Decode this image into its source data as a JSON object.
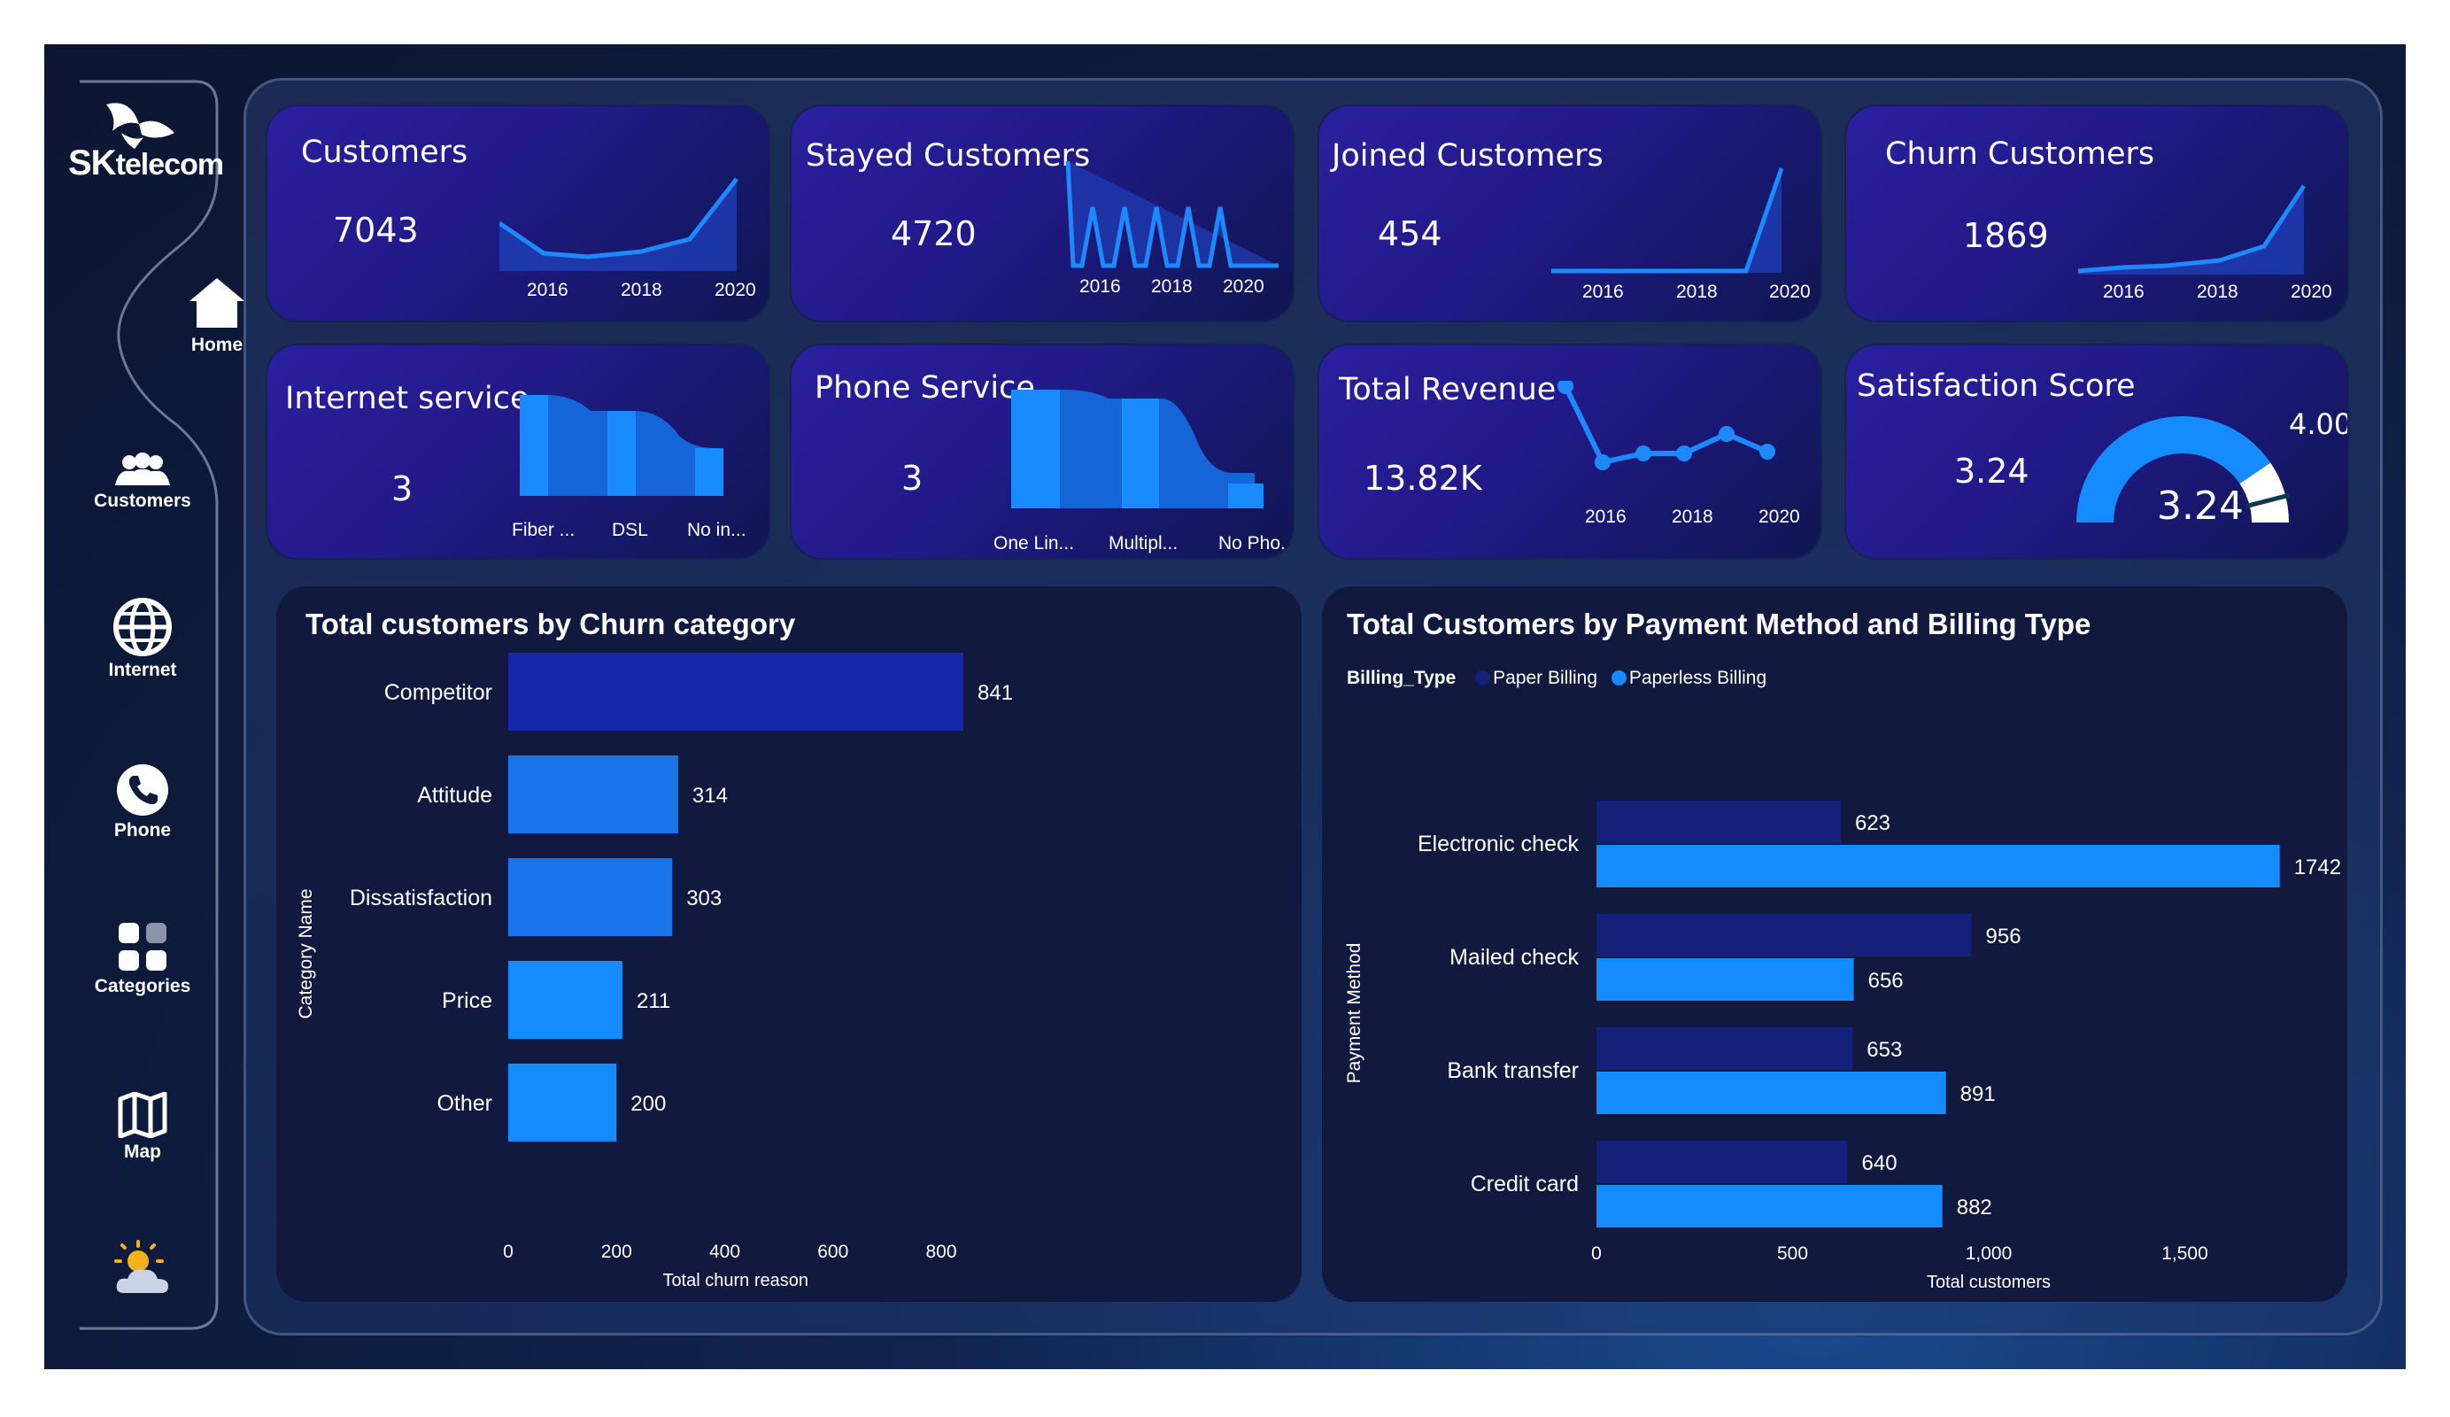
{
  "brand": {
    "name_main": "SK",
    "name_sub": "telecom"
  },
  "sidebar": {
    "items": [
      {
        "label": "Home",
        "icon": "home-icon"
      },
      {
        "label": "Customers",
        "icon": "users-icon"
      },
      {
        "label": "Internet",
        "icon": "globe-icon"
      },
      {
        "label": "Phone",
        "icon": "phone-icon"
      },
      {
        "label": "Categories",
        "icon": "grid-icon"
      },
      {
        "label": "Map",
        "icon": "map-icon"
      },
      {
        "label": "",
        "icon": "weather-icon"
      }
    ]
  },
  "kpi_cards": {
    "customers": {
      "title": "Customers",
      "value": "7043",
      "ticks": [
        "2016",
        "2018",
        "2020"
      ]
    },
    "stayed": {
      "title": "Stayed Customers",
      "value": "4720",
      "ticks": [
        "2016",
        "2018",
        "2020"
      ]
    },
    "joined": {
      "title": "Joined Customers",
      "value": "454",
      "ticks": [
        "2016",
        "2018",
        "2020"
      ]
    },
    "churn": {
      "title": "Churn Customers",
      "value": "1869",
      "ticks": [
        "2016",
        "2018",
        "2020"
      ]
    },
    "internet": {
      "title": "Internet service",
      "value": "3",
      "ticks": [
        "Fiber ...",
        "DSL",
        "No in..."
      ]
    },
    "phone": {
      "title": "Phone Service",
      "value": "3",
      "ticks": [
        "One Lin...",
        "Multipl...",
        "No Pho..."
      ]
    },
    "revenue": {
      "title": "Total Revenue",
      "value": "13.82K",
      "ticks": [
        "2016",
        "2018",
        "2020"
      ]
    },
    "satisfaction": {
      "title": "Satisfaction Score",
      "value": "3.24",
      "gauge_value": "3.24",
      "gauge_max": "4.00",
      "gauge_fraction": 0.81
    }
  },
  "chart_data": [
    {
      "type": "bar",
      "orientation": "horizontal",
      "title": "Total customers by Churn category",
      "xlabel": "Total churn reason",
      "ylabel": "Category Name",
      "categories": [
        "Competitor",
        "Attitude",
        "Dissatisfaction",
        "Price",
        "Other"
      ],
      "values": [
        841,
        314,
        303,
        211,
        200
      ],
      "xticks": [
        "0",
        "200",
        "400",
        "600",
        "800"
      ],
      "xlim": [
        0,
        900
      ],
      "colors": [
        "#1626a8",
        "#1a73e8",
        "#1a73e8",
        "#148bff",
        "#148bff"
      ]
    },
    {
      "type": "bar",
      "orientation": "horizontal",
      "title": "Total Customers by Payment Method and Billing Type",
      "xlabel": "Total customers",
      "ylabel": "Payment Method",
      "legend_title": "Billing_Type",
      "legend_position": "top-left",
      "categories": [
        "Electronic check",
        "Mailed check",
        "Bank transfer",
        "Credit card"
      ],
      "series": [
        {
          "name": "Paper Billing",
          "values": [
            623,
            956,
            653,
            640
          ],
          "color": "#14207a"
        },
        {
          "name": "Paperless Billing",
          "values": [
            1742,
            656,
            891,
            882
          ],
          "color": "#148bff"
        }
      ],
      "xticks": [
        "0",
        "500",
        "1,000",
        "1,500"
      ],
      "xlim": [
        0,
        1900
      ]
    }
  ]
}
